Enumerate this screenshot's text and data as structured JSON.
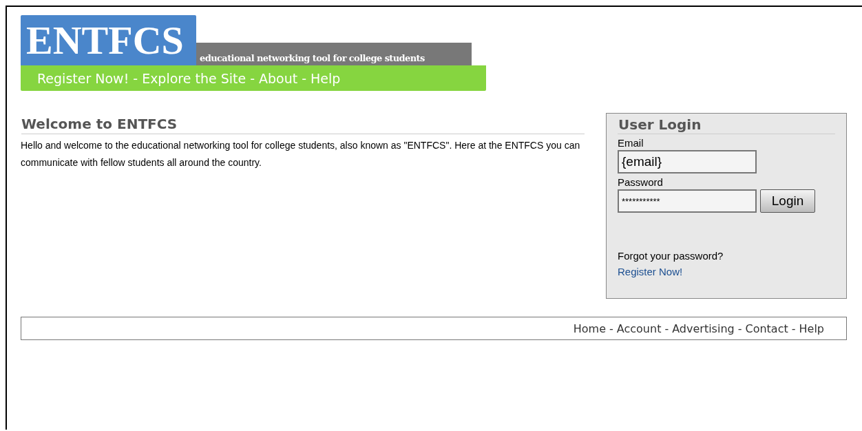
{
  "header": {
    "logo": "ENTFCS",
    "tagline": "educational networking tool for college students",
    "nav": [
      {
        "label": "Register Now!"
      },
      {
        "label": "Explore the Site"
      },
      {
        "label": "About"
      },
      {
        "label": "Help"
      }
    ],
    "separator": "-"
  },
  "welcome": {
    "title": "Welcome to ENTFCS",
    "text": "Hello and welcome to the educational networking tool for college students, also known as \"ENTFCS\". Here at the ENTFCS you can communicate with fellow students all around the country."
  },
  "login": {
    "title": "User Login",
    "email_label": "Email",
    "email_value": "{email}",
    "password_label": "Password",
    "password_value": "***********",
    "button": "Login",
    "forgot": "Forgot your password?",
    "register": "Register Now!"
  },
  "footer": {
    "links": [
      {
        "label": "Home"
      },
      {
        "label": "Account"
      },
      {
        "label": "Advertising"
      },
      {
        "label": "Contact"
      },
      {
        "label": "Help"
      }
    ],
    "separator": "-"
  }
}
